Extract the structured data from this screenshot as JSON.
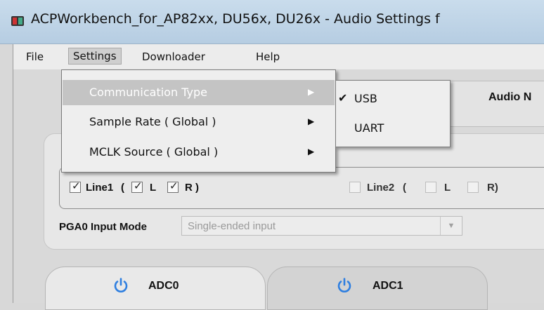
{
  "window": {
    "title": "ACPWorkbench_for_AP82xx, DU56x, DU26x - Audio Settings f"
  },
  "menubar": {
    "items": [
      {
        "label": "File"
      },
      {
        "label": "Settings"
      },
      {
        "label": "Downloader"
      },
      {
        "label": "Help"
      }
    ]
  },
  "settings_menu": {
    "items": [
      {
        "label": "Communication Type",
        "highlighted": true,
        "has_submenu": true
      },
      {
        "label": "Sample Rate ( Global )",
        "highlighted": false,
        "has_submenu": true
      },
      {
        "label": "MCLK Source  ( Global )",
        "highlighted": false,
        "has_submenu": true
      }
    ],
    "submenu_arrow": "▶"
  },
  "communication_submenu": {
    "items": [
      {
        "label": "USB",
        "checked": true
      },
      {
        "label": "UART",
        "checked": false
      }
    ],
    "check_glyph": "✔"
  },
  "audio_tab": {
    "label": "Audio N"
  },
  "line_inputs": {
    "line1": {
      "label": "Line1",
      "checked": true,
      "open_paren": "(",
      "close_paren": ")",
      "l_label": "L",
      "l_checked": true,
      "r_label": "R",
      "r_checked": true
    },
    "line2": {
      "label": "Line2",
      "checked": false,
      "open_paren": "(",
      "l_label": "L",
      "l_checked": false,
      "r_label": "R)",
      "r_checked": false
    },
    "check_glyph": "✓"
  },
  "pga": {
    "label": "PGA0 Input Mode",
    "value": "Single-ended input",
    "arrow": "▼"
  },
  "adc_tabs": [
    {
      "label": "ADC0",
      "active": true
    },
    {
      "label": "ADC1",
      "active": false
    }
  ],
  "colors": {
    "power_icon": "#2f7fe0",
    "menu_highlight": "#c4c4c4"
  }
}
